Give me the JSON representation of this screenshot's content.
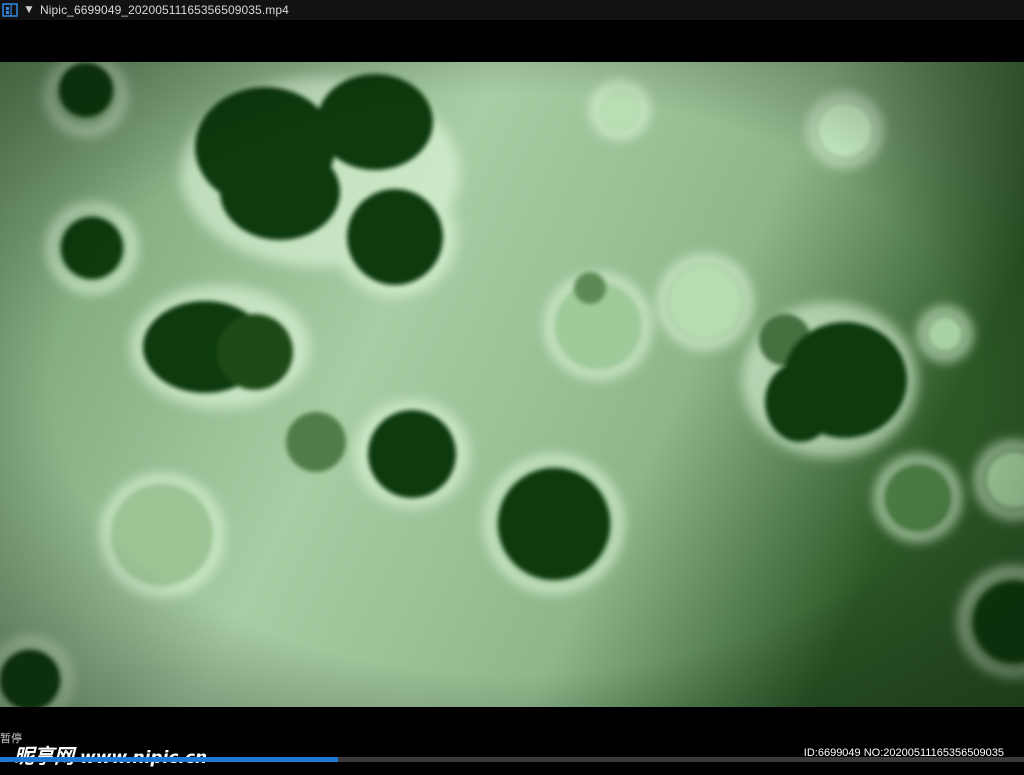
{
  "window": {
    "title": "Nipic_6699049_20200511165356509035.mp4",
    "app_icon": "film-strip-icon",
    "menu_icon": "chevron-down-icon",
    "accent_color": "#1f7ad6"
  },
  "player": {
    "status": "暂停",
    "progress_fraction": 0.33
  },
  "watermark": {
    "logo_text": "昵享网",
    "url": "www.nipic.cn",
    "id_text": "ID:6699049 NO:20200511165356509035"
  }
}
